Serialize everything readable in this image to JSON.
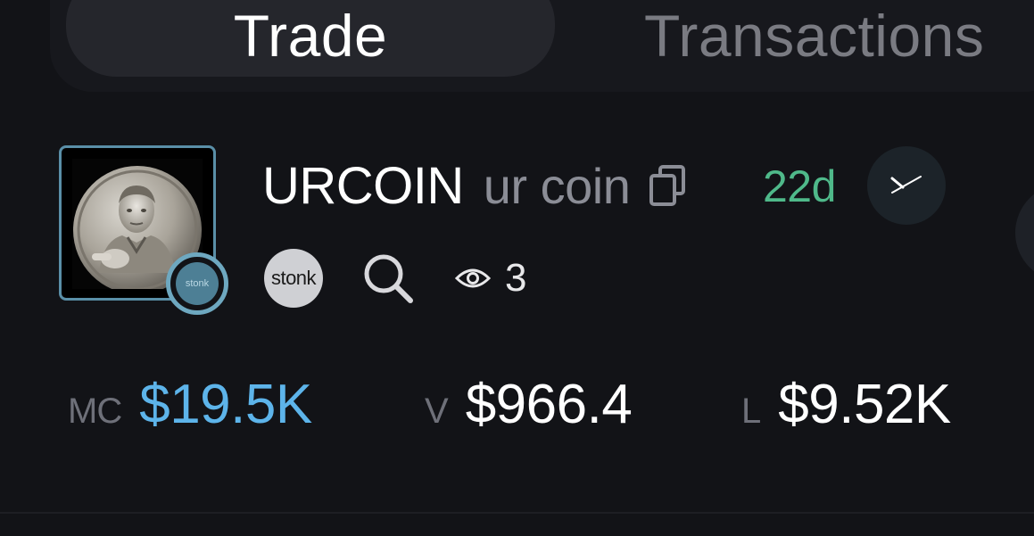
{
  "tabs": [
    {
      "label": "Trade",
      "active": true
    },
    {
      "label": "Transactions",
      "active": false
    }
  ],
  "token": {
    "ticker": "URCOIN",
    "name": "ur coin",
    "age": "22d",
    "avatar_badge": "stonk",
    "platform_badge": "stonk",
    "views": "3",
    "icons": {
      "copy": "copy-icon",
      "x": "x-icon",
      "search": "search-icon",
      "eye": "eye-icon"
    }
  },
  "stats": [
    {
      "label": "MC",
      "value": "$19.5K"
    },
    {
      "label": "V",
      "value": "$966.4"
    },
    {
      "label": "L",
      "value": "$9.52K"
    }
  ],
  "colors": {
    "background": "#121317",
    "mc_value": "#5db4ea",
    "age": "#4fb98a",
    "muted": "#8b8d96",
    "avatar_border": "#5a8fa8"
  }
}
